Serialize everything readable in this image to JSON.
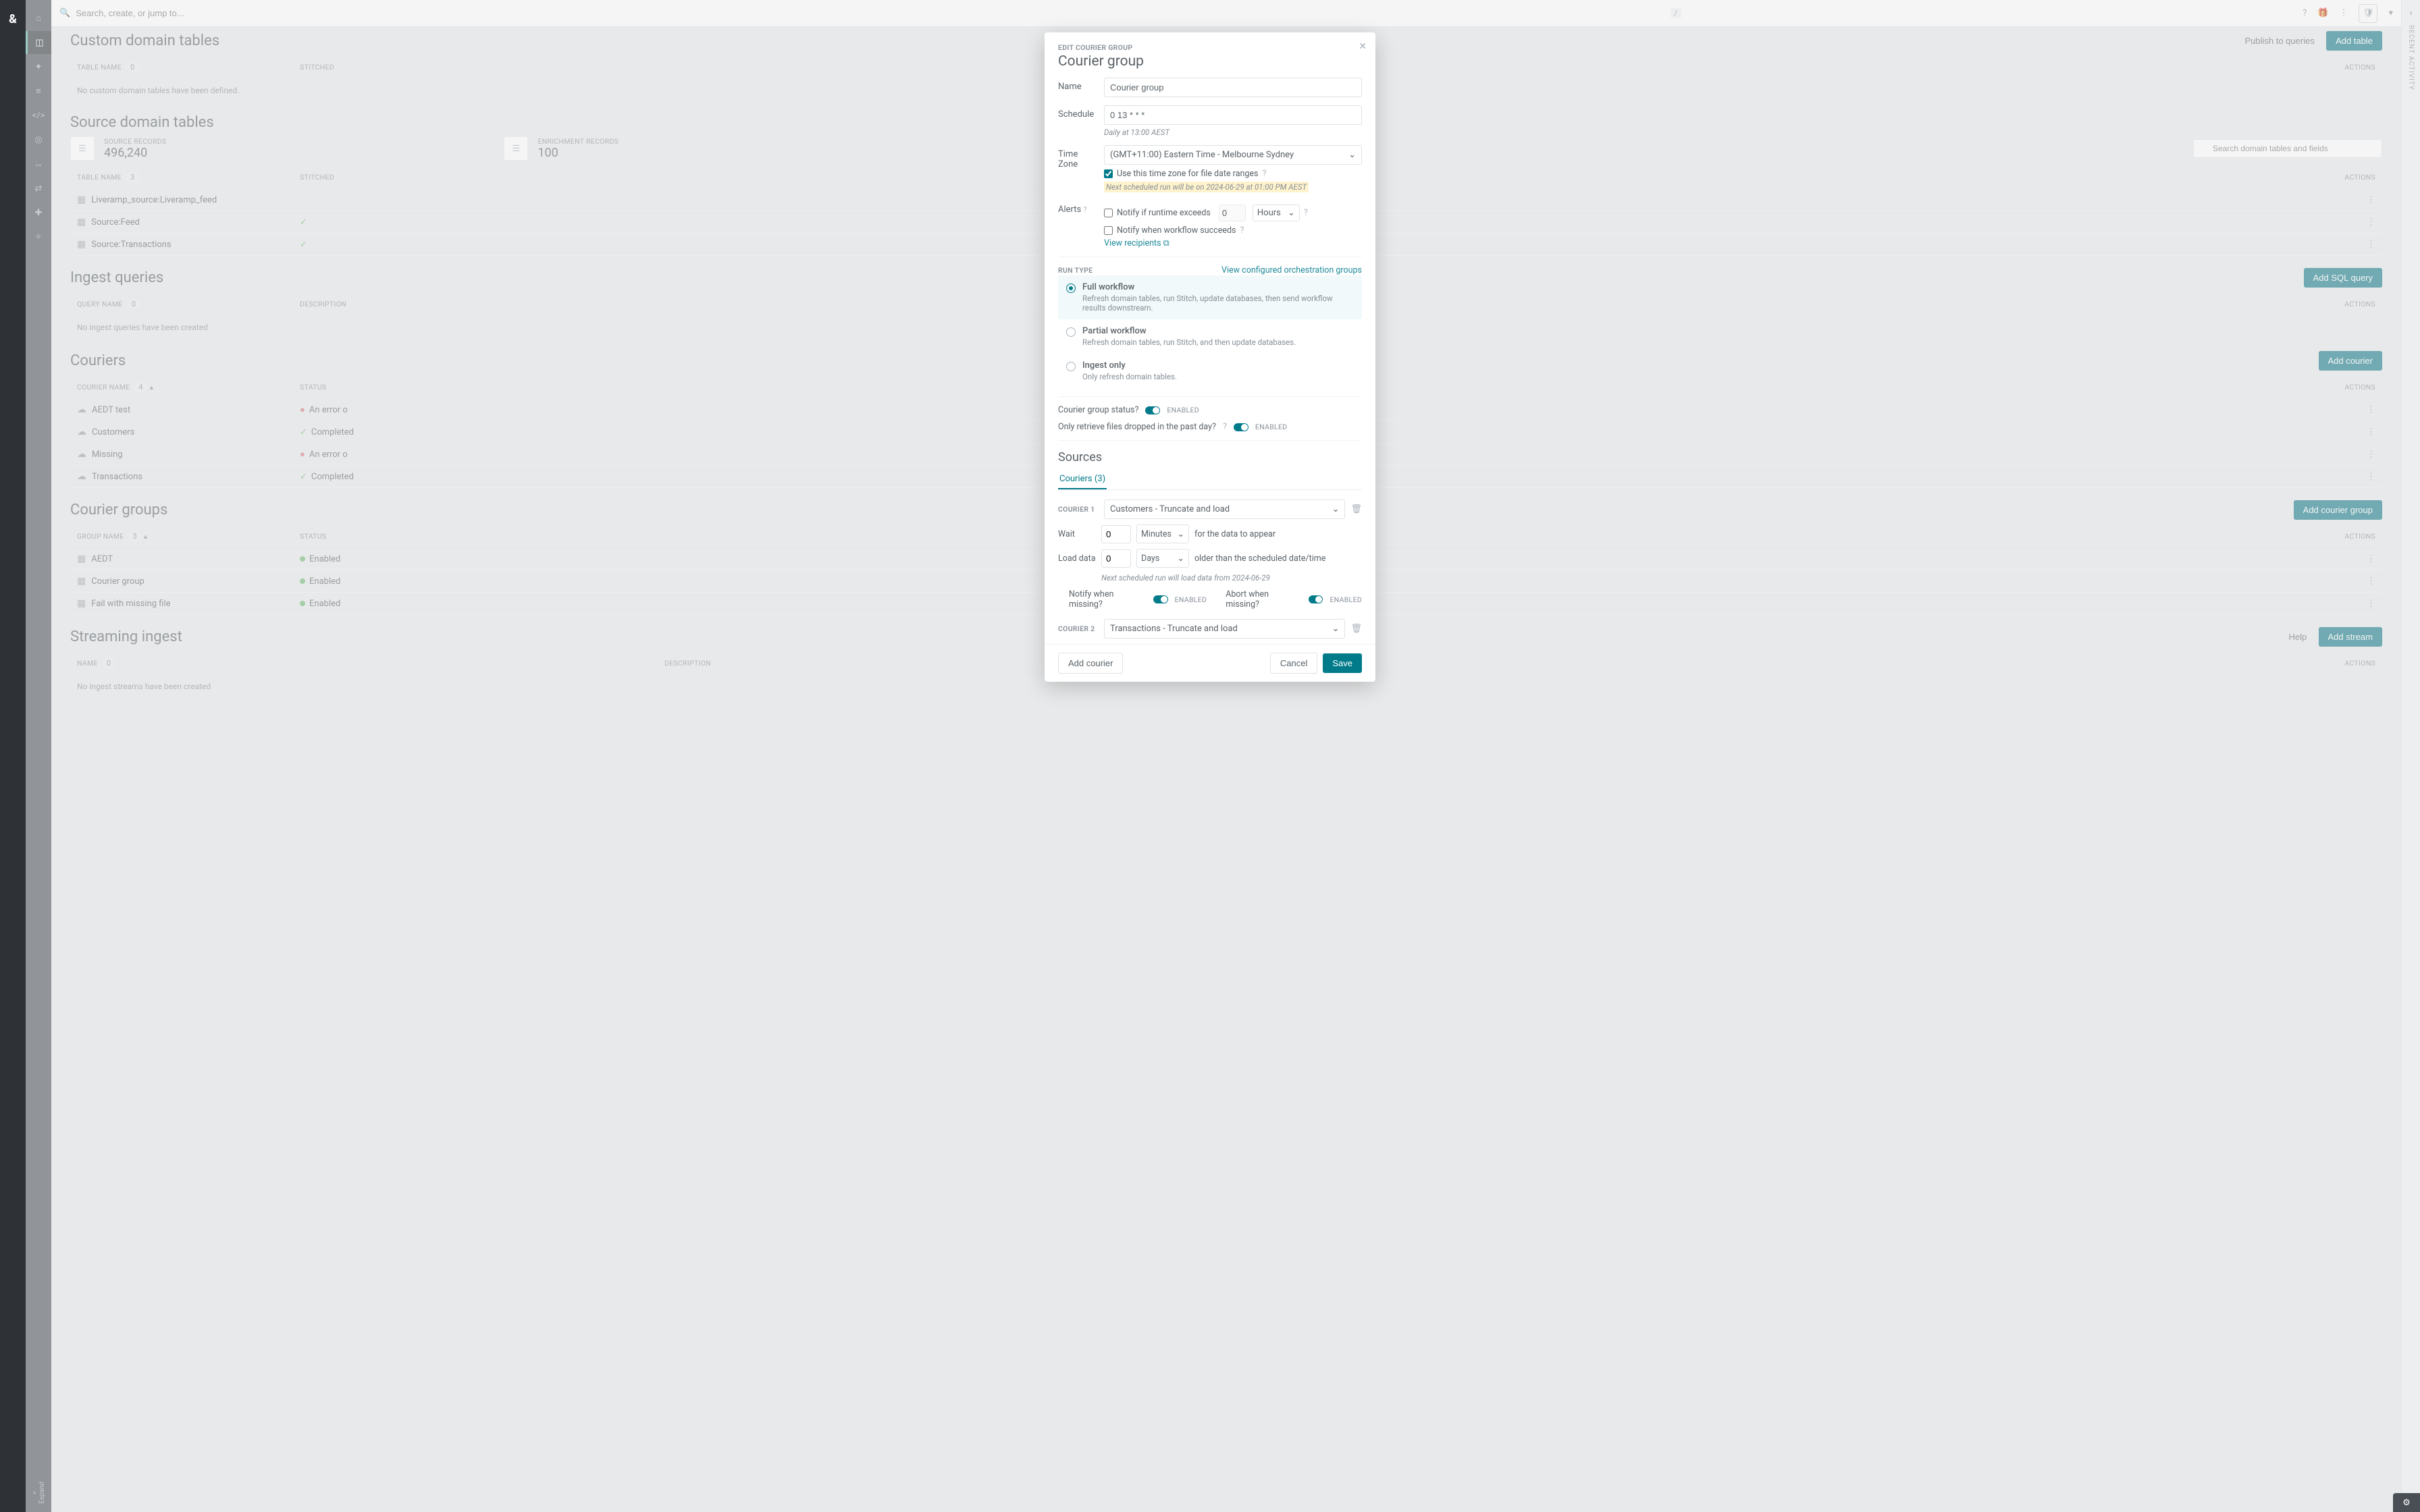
{
  "topbar": {
    "search_placeholder": "Search, create, or jump to...",
    "shortcut": "/"
  },
  "nav": {
    "expand_label": "Expand"
  },
  "sections": {
    "custom_tables": {
      "title": "Custom domain tables",
      "publish": "Publish to queries",
      "add": "Add table",
      "th_name": "TABLE NAME",
      "count": "0",
      "th_stitch": "STITCHED",
      "th_actions": "ACTIONS",
      "empty": "No custom domain tables have been defined."
    },
    "source_tables": {
      "title": "Source domain tables",
      "stat1_label": "SOURCE RECORDS",
      "stat1_value": "496,240",
      "stat2_label": "ENRICHMENT RECORDS",
      "stat2_value": "100",
      "search_placeholder": "Search domain tables and fields",
      "th_name": "TABLE NAME",
      "count": "3",
      "th_stitch": "STITCHED",
      "th_actions": "ACTIONS",
      "rows": [
        {
          "name": "Liveramp_source:Liveramp_feed",
          "stitched": false
        },
        {
          "name": "Source:Feed",
          "stitched": true
        },
        {
          "name": "Source:Transactions",
          "stitched": true
        }
      ]
    },
    "ingest_queries": {
      "title": "Ingest queries",
      "add": "Add SQL query",
      "th_name": "QUERY NAME",
      "count": "0",
      "th_desc": "DESCRIPTION",
      "th_actions": "ACTIONS",
      "empty": "No ingest queries have been created"
    },
    "couriers": {
      "title": "Couriers",
      "add": "Add courier",
      "th_name": "COURIER NAME",
      "count": "4",
      "th_status": "STATUS",
      "th_actions": "ACTIONS",
      "rows": [
        {
          "name": "AEDT test",
          "icon": "cloud",
          "status": "An error o",
          "kind": "error"
        },
        {
          "name": "Customers",
          "icon": "cloud",
          "status": "Completed",
          "kind": "complete"
        },
        {
          "name": "Missing",
          "icon": "cloud",
          "status": "An error o",
          "kind": "error"
        },
        {
          "name": "Transactions",
          "icon": "cloud",
          "status": "Completed",
          "kind": "complete"
        }
      ]
    },
    "courier_groups": {
      "title": "Courier groups",
      "add": "Add courier group",
      "th_name": "GROUP NAME",
      "count": "3",
      "th_status": "STATUS",
      "th_actions": "ACTIONS",
      "rows": [
        {
          "name": "AEDT",
          "status": "Enabled"
        },
        {
          "name": "Courier group",
          "status": "Enabled"
        },
        {
          "name": "Fail with missing file",
          "status": "Enabled"
        }
      ]
    },
    "streaming": {
      "title": "Streaming ingest",
      "help": "Help",
      "add": "Add stream",
      "th_name": "NAME",
      "count": "0",
      "th_desc": "DESCRIPTION",
      "th_actions": "ACTIONS",
      "empty": "No ingest streams have been created"
    }
  },
  "activity": {
    "label": "RECENT ACTIVITY"
  },
  "modal": {
    "eyebrow": "EDIT COURIER GROUP",
    "title": "Courier group",
    "labels": {
      "name": "Name",
      "schedule": "Schedule",
      "timezone": "Time Zone",
      "alerts": "Alerts",
      "run_type": "RUN TYPE",
      "wait": "Wait",
      "load_data": "Load data"
    },
    "values": {
      "name": "Courier group",
      "schedule": "0 13 * * *",
      "schedule_help": "Daily at 13:00 AEST",
      "timezone": "(GMT+11:00) Eastern Time - Melbourne Sydney",
      "use_tz": "Use this time zone for file date ranges",
      "next_run": "Next scheduled run will be on 2024-06-29 at 01:00 PM AEST",
      "notify_runtime": "Notify if runtime exceeds",
      "hours_val": "0",
      "hours_unit": "Hours",
      "notify_success": "Notify when workflow succeeds",
      "view_recipients": "View recipients",
      "view_orch": "View configured orchestration groups"
    },
    "run_types": [
      {
        "title": "Full workflow",
        "desc": "Refresh domain tables, run Stitch, update databases, then send workflow results downstream.",
        "selected": true
      },
      {
        "title": "Partial workflow",
        "desc": "Refresh domain tables, run Stitch, and then update databases.",
        "selected": false
      },
      {
        "title": "Ingest only",
        "desc": "Only refresh domain tables.",
        "selected": false
      }
    ],
    "toggles": {
      "group_status_q": "Courier group status?",
      "group_status_v": "ENABLED",
      "past_day_q": "Only retrieve files dropped in the past day?",
      "past_day_v": "ENABLED"
    },
    "sources": {
      "title": "Sources",
      "tab": "Couriers (3)",
      "couriers": [
        {
          "label": "COURIER 1",
          "select": "Customers - Truncate and load",
          "wait_val": "0",
          "wait_unit": "Minutes",
          "wait_tail": "for the data to appear",
          "load_val": "0",
          "load_unit": "Days",
          "load_tail": "older than the scheduled date/time",
          "next_load": "Next scheduled run will load data from 2024-06-29",
          "notify_missing_q": "Notify when missing?",
          "notify_missing_v": "ENABLED",
          "abort_missing_q": "Abort when missing?",
          "abort_missing_v": "ENABLED"
        },
        {
          "label": "COURIER 2",
          "select": "Transactions - Truncate and load"
        }
      ]
    },
    "footer": {
      "add_courier": "Add courier",
      "cancel": "Cancel",
      "save": "Save"
    }
  }
}
